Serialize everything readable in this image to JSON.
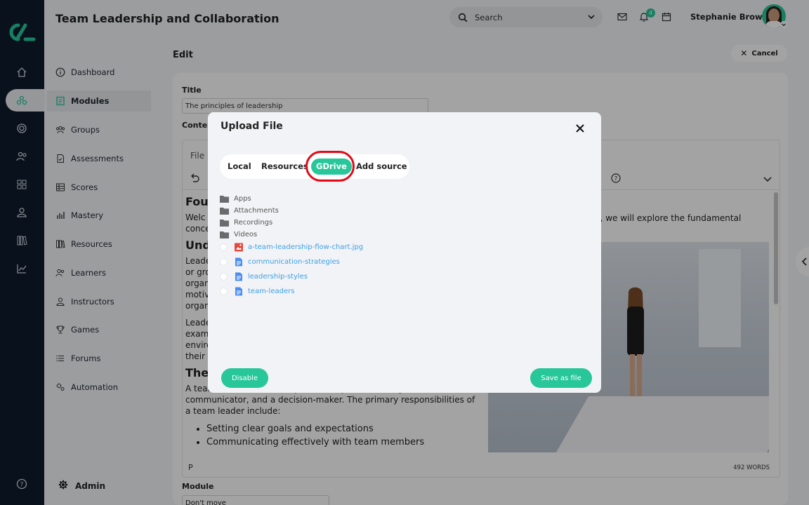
{
  "app": {
    "title": "Team Leadership and Collaboration",
    "user_name": "Stephanie Brown",
    "notification_count": "4",
    "search_placeholder": "Search"
  },
  "colors": {
    "brand": "#27c79a",
    "rail": "#0f1b2d",
    "highlight": "#e10a17",
    "link": "#3fa0e6"
  },
  "nav": {
    "items": [
      {
        "label": "Dashboard",
        "icon": "info-icon"
      },
      {
        "label": "Modules",
        "icon": "modules-icon"
      },
      {
        "label": "Groups",
        "icon": "groups-icon"
      },
      {
        "label": "Assessments",
        "icon": "assessments-icon"
      },
      {
        "label": "Scores",
        "icon": "scores-icon"
      },
      {
        "label": "Mastery",
        "icon": "mastery-icon"
      },
      {
        "label": "Resources",
        "icon": "resources-icon"
      },
      {
        "label": "Learners",
        "icon": "learners-icon"
      },
      {
        "label": "Instructors",
        "icon": "instructors-icon"
      },
      {
        "label": "Games",
        "icon": "trophy-icon"
      },
      {
        "label": "Forums",
        "icon": "forums-icon"
      },
      {
        "label": "Automation",
        "icon": "automation-icon"
      }
    ],
    "admin_label": "Admin"
  },
  "main": {
    "edit_label": "Edit",
    "cancel_label": "Cancel",
    "title_label": "Title",
    "title_value": "The principles of leadership",
    "content_label": "Conten",
    "editor_file_menu": "File",
    "doc_h1": "Fou",
    "doc_p1a": "Welc",
    "doc_p1b": "conce",
    "doc_p1_right": "n, we will explore the fundamental",
    "doc_h2": "Unde",
    "doc_p2": [
      "Leade",
      "or gro",
      "organ",
      "motiv",
      "organ"
    ],
    "doc_p3": [
      "Leade",
      "examp",
      "enviro",
      "their b"
    ],
    "doc_h3": "The",
    "doc_p4": "A team leader wears many hats. They are a strategist, a mentor, a communicator, and a decision-maker. The primary responsibilities of a team leader include:",
    "doc_li": [
      "Setting clear goals and expectations",
      "Communicating effectively with team members"
    ],
    "path_marker": "P",
    "word_count": "492 WORDS",
    "module_label": "Module",
    "module_value": "Don't move"
  },
  "modal": {
    "title": "Upload File",
    "tabs": [
      "Local",
      "Resources",
      "GDrive",
      "Add source"
    ],
    "active_tab": "GDrive",
    "folders": [
      "Apps",
      "Attachments",
      "Recordings",
      "Videos"
    ],
    "files": [
      {
        "name": "a-team-leadership-flow-chart.jpg",
        "type": "image"
      },
      {
        "name": "communication-strategies",
        "type": "doc"
      },
      {
        "name": "leadership-styles",
        "type": "doc"
      },
      {
        "name": "team-leaders",
        "type": "doc"
      }
    ],
    "disable_label": "Disable",
    "save_label": "Save as file"
  }
}
